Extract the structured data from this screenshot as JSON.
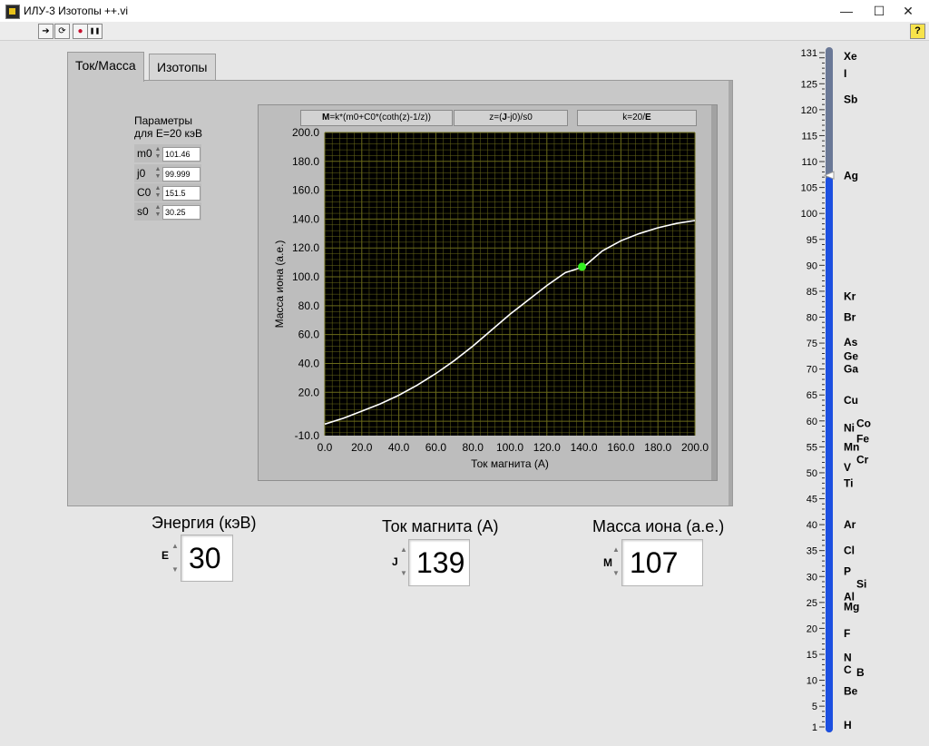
{
  "window": {
    "title": "ИЛУ-3 Изотопы ++.vi",
    "minimize": "—",
    "maximize": "☐",
    "close": "✕"
  },
  "toolbar": {
    "run": "➔",
    "run_cont": "⟳",
    "abort": "●",
    "pause": "❚❚",
    "help": "?"
  },
  "tabs": [
    {
      "label": "Ток/Масса"
    },
    {
      "label": "Изотопы"
    }
  ],
  "params": {
    "title_line1": "Параметры",
    "title_line2": "для E=20 кэВ",
    "rows": [
      {
        "label": "m0",
        "value": "101.46"
      },
      {
        "label": "j0",
        "value": "99.999"
      },
      {
        "label": "C0",
        "value": "151.5"
      },
      {
        "label": "s0",
        "value": "30.25"
      }
    ]
  },
  "formulas": [
    {
      "bold": "M",
      "text": "=k*(m0+C0*(coth(z)-1/z))"
    },
    {
      "pre": "z=(",
      "bold": "J",
      "post": "-j0)/s0"
    },
    {
      "pre": "k=20/",
      "bold": "E"
    }
  ],
  "chart_data": {
    "type": "line",
    "xlabel": "Ток магнита (А)",
    "ylabel": "Масса иона (а.е.)",
    "xlim": [
      0,
      200
    ],
    "ylim": [
      -10,
      200
    ],
    "x_ticks": [
      "0.0",
      "20.0",
      "40.0",
      "60.0",
      "80.0",
      "100.0",
      "120.0",
      "140.0",
      "160.0",
      "180.0",
      "200.0"
    ],
    "y_ticks": [
      "-10.0",
      "20.0",
      "40.0",
      "60.0",
      "80.0",
      "100.0",
      "120.0",
      "140.0",
      "160.0",
      "180.0",
      "200.0"
    ],
    "grid": true,
    "series": [
      {
        "x": [
          0,
          10,
          20,
          30,
          40,
          50,
          60,
          70,
          80,
          90,
          100,
          110,
          120,
          130,
          140,
          150,
          160,
          170,
          180,
          190,
          200
        ],
        "y": [
          -2,
          2,
          7,
          12,
          18,
          25,
          33,
          42,
          52,
          63,
          74,
          84,
          94,
          103,
          107,
          118,
          125,
          130,
          134,
          137,
          139
        ]
      }
    ],
    "marker": {
      "x": 139,
      "y": 107
    },
    "colors": {
      "background": "#000000",
      "grid": "#6b6b1a",
      "line": "#ffffff",
      "marker": "#33ee22"
    }
  },
  "indicators": {
    "energy": {
      "label": "Энергия (кэВ)",
      "letter": "E",
      "value": "30"
    },
    "current": {
      "label": "Ток магнита (А)",
      "letter": "J",
      "value": "139"
    },
    "mass": {
      "label": "Масса иона (а.е.)",
      "letter": "M",
      "value": "107"
    }
  },
  "scale": {
    "min": 1,
    "max": 131,
    "value": 107,
    "ticks": [
      "131",
      "125",
      "120",
      "115",
      "110",
      "105",
      "100",
      "95",
      "90",
      "85",
      "80",
      "75",
      "70",
      "65",
      "60",
      "55",
      "50",
      "45",
      "40",
      "35",
      "30",
      "25",
      "20",
      "15",
      "10",
      "5",
      "1"
    ],
    "elements": [
      {
        "sym": "Xe",
        "mass": 131
      },
      {
        "sym": "I",
        "mass": 127
      },
      {
        "sym": "Sb",
        "mass": 122
      },
      {
        "sym": "Ag",
        "mass": 108
      },
      {
        "sym": "Kr",
        "mass": 84
      },
      {
        "sym": "Br",
        "mass": 80
      },
      {
        "sym": "As",
        "mass": 75
      },
      {
        "sym": "Ge",
        "mass": 73
      },
      {
        "sym": "Ga",
        "mass": 70
      },
      {
        "sym": "Cu",
        "mass": 64
      },
      {
        "sym": "Ni",
        "mass": 59
      },
      {
        "sym": "Co",
        "mass": 59
      },
      {
        "sym": "Mn",
        "mass": 55
      },
      {
        "sym": "Fe",
        "mass": 56
      },
      {
        "sym": "V",
        "mass": 51
      },
      {
        "sym": "Cr",
        "mass": 52
      },
      {
        "sym": "Ti",
        "mass": 48
      },
      {
        "sym": "Ar",
        "mass": 40
      },
      {
        "sym": "Cl",
        "mass": 35
      },
      {
        "sym": "P",
        "mass": 31
      },
      {
        "sym": "Si",
        "mass": 28
      },
      {
        "sym": "Al",
        "mass": 27
      },
      {
        "sym": "Mg",
        "mass": 24
      },
      {
        "sym": "F",
        "mass": 19
      },
      {
        "sym": "N",
        "mass": 14
      },
      {
        "sym": "C",
        "mass": 12
      },
      {
        "sym": "B",
        "mass": 11
      },
      {
        "sym": "Be",
        "mass": 9
      },
      {
        "sym": "H",
        "mass": 1
      }
    ],
    "colors": {
      "fill": "#1c4fe0",
      "track": "#6a7896"
    }
  }
}
